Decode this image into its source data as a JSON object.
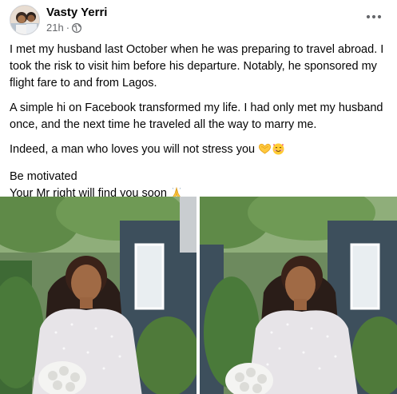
{
  "post": {
    "author": "Vasty Yerri",
    "timestamp": "21h",
    "separator": "·",
    "privacy_icon": "globe-icon",
    "more_icon": "more-options-icon",
    "paragraphs": {
      "p1": "I met my husband last October when he was preparing to travel abroad. I took the risk to visit him before his departure. Notably, he sponsored my flight fare to and from Lagos.",
      "p2": "A simple hi on Facebook transformed my life. I had only met my husband once, and the next time he traveled all the way to marry me.",
      "p3": "Indeed, a man who loves you will not stress you",
      "p4_line1": "Be motivated",
      "p4_line2": "Your Mr right will find you soon"
    },
    "emojis": {
      "p3": [
        "heart-hands-emoji",
        "smiling-face-with-hearts-emoji"
      ],
      "p4": [
        "folded-hands-emoji"
      ]
    }
  },
  "photos": [
    {
      "name": "bride-photo-left",
      "subject": "bride in sequined white gown holding white rose bouquet"
    },
    {
      "name": "bride-photo-right",
      "subject": "bride in sequined white gown holding white rose bouquet, smiling"
    }
  ],
  "colors": {
    "text": "#050505",
    "secondary_text": "#65676b",
    "foliage": "#4f7a3a",
    "wall": "#3d4f5c"
  }
}
